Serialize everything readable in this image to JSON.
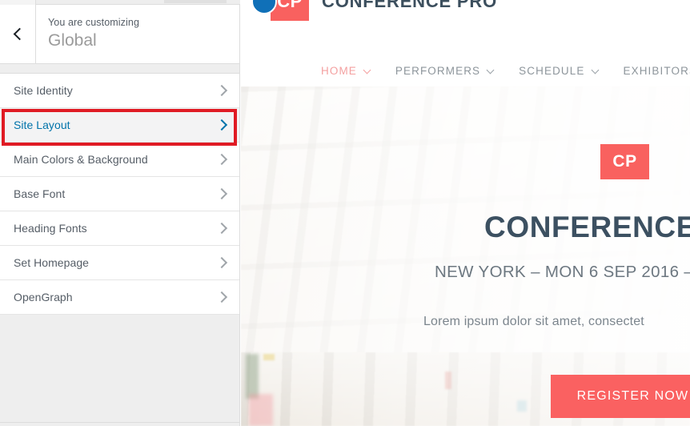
{
  "customizer": {
    "back_label": "Back",
    "subtitle": "You are customizing",
    "title": "Global",
    "sections": [
      {
        "label": "Site Identity",
        "active": false
      },
      {
        "label": "Site Layout",
        "active": true
      },
      {
        "label": "Main Colors & Background",
        "active": false
      },
      {
        "label": "Base Font",
        "active": false
      },
      {
        "label": "Heading Fonts",
        "active": false
      },
      {
        "label": "Set Homepage",
        "active": false
      },
      {
        "label": "OpenGraph",
        "active": false
      }
    ],
    "highlight_color": "#e01b24",
    "active_color": "#0073aa"
  },
  "preview": {
    "brand": {
      "badge_text": "CP",
      "name": "CONFERENCE PRO",
      "badge_color": "#f9615f",
      "dot_color": "#1070b8",
      "name_color": "#3c4f5e"
    },
    "nav": [
      {
        "label": "HOME",
        "caret": true,
        "current": true
      },
      {
        "label": "PERFORMERS",
        "caret": true,
        "current": false
      },
      {
        "label": "SCHEDULE",
        "caret": true,
        "current": false
      },
      {
        "label": "EXHIBITORS",
        "caret": false,
        "current": false
      }
    ],
    "hero": {
      "badge_text": "CP",
      "title": "CONFERENCE",
      "subtitle": "NEW YORK – MON 6 SEP 2016 –",
      "description": "Lorem ipsum dolor sit amet, consectet",
      "cta_label": "REGISTER NOW",
      "cta_color": "#fa6161",
      "title_color": "#3c5061"
    }
  }
}
